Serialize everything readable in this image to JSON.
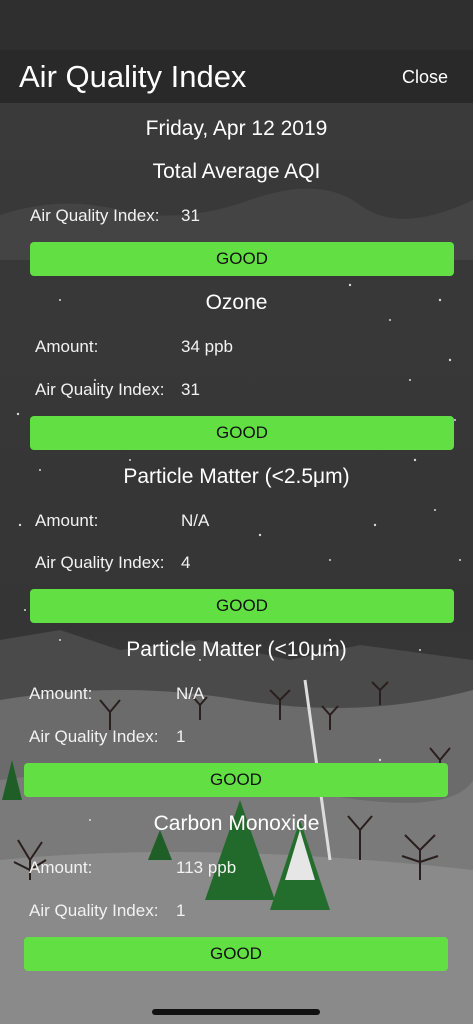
{
  "nav": {
    "title": "Air Quality Index",
    "close_label": "Close"
  },
  "date": "Friday, Apr 12 2019",
  "total": {
    "title": "Total Average AQI",
    "aqi_label": "Air Quality Index:",
    "aqi_value": "31",
    "grade": "GOOD"
  },
  "pollutants": [
    {
      "title": "Ozone",
      "amount_label": "Amount:",
      "amount_value": "34 ppb",
      "aqi_label": "Air Quality Index:",
      "aqi_value": "31",
      "grade": "GOOD"
    },
    {
      "title": "Particle Matter (<2.5μm)",
      "amount_label": "Amount:",
      "amount_value": "N/A",
      "aqi_label": "Air Quality Index:",
      "aqi_value": "4",
      "grade": "GOOD"
    },
    {
      "title": "Particle Matter (<10μm)",
      "amount_label": "Amount:",
      "amount_value": "N/A",
      "aqi_label": "Air Quality Index:",
      "aqi_value": "1",
      "grade": "GOOD"
    },
    {
      "title": "Carbon Monoxide",
      "amount_label": "Amount:",
      "amount_value": "113 ppb",
      "aqi_label": "Air Quality Index:",
      "aqi_value": "1",
      "grade": "GOOD"
    }
  ],
  "colors": {
    "grade_good": "#62e043",
    "nav_background": "#282828"
  }
}
